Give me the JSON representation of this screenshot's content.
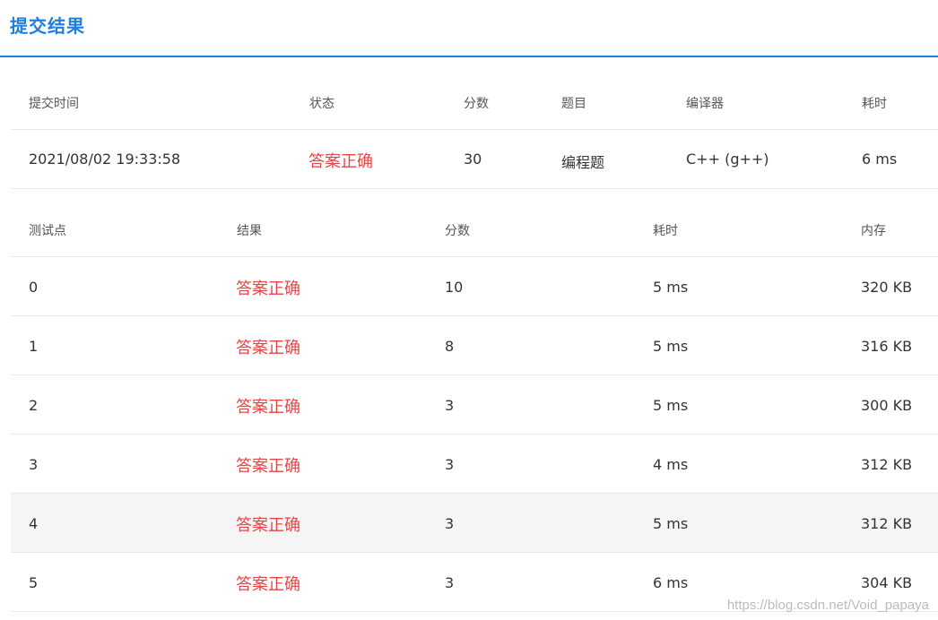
{
  "header": {
    "title": "提交结果"
  },
  "summary": {
    "columns": [
      "提交时间",
      "状态",
      "分数",
      "题目",
      "编译器",
      "耗时"
    ],
    "row": {
      "submit_time": "2021/08/02 19:33:58",
      "status": "答案正确",
      "score": "30",
      "problem": "编程题",
      "compiler": "C++ (g++)",
      "time": "6 ms"
    }
  },
  "tests": {
    "columns": [
      "测试点",
      "结果",
      "分数",
      "耗时",
      "内存"
    ],
    "rows": [
      {
        "id": "0",
        "result": "答案正确",
        "score": "10",
        "time": "5 ms",
        "memory": "320 KB"
      },
      {
        "id": "1",
        "result": "答案正确",
        "score": "8",
        "time": "5 ms",
        "memory": "316 KB"
      },
      {
        "id": "2",
        "result": "答案正确",
        "score": "3",
        "time": "5 ms",
        "memory": "300 KB"
      },
      {
        "id": "3",
        "result": "答案正确",
        "score": "3",
        "time": "4 ms",
        "memory": "312 KB"
      },
      {
        "id": "4",
        "result": "答案正确",
        "score": "3",
        "time": "5 ms",
        "memory": "312 KB"
      },
      {
        "id": "5",
        "result": "答案正确",
        "score": "3",
        "time": "6 ms",
        "memory": "304 KB"
      }
    ]
  },
  "colors": {
    "accent": "#1e7fe0",
    "status_ok": "#e64545",
    "hover_row": "#f5f5f5"
  },
  "watermark": "https://blog.csdn.net/Void_papaya"
}
